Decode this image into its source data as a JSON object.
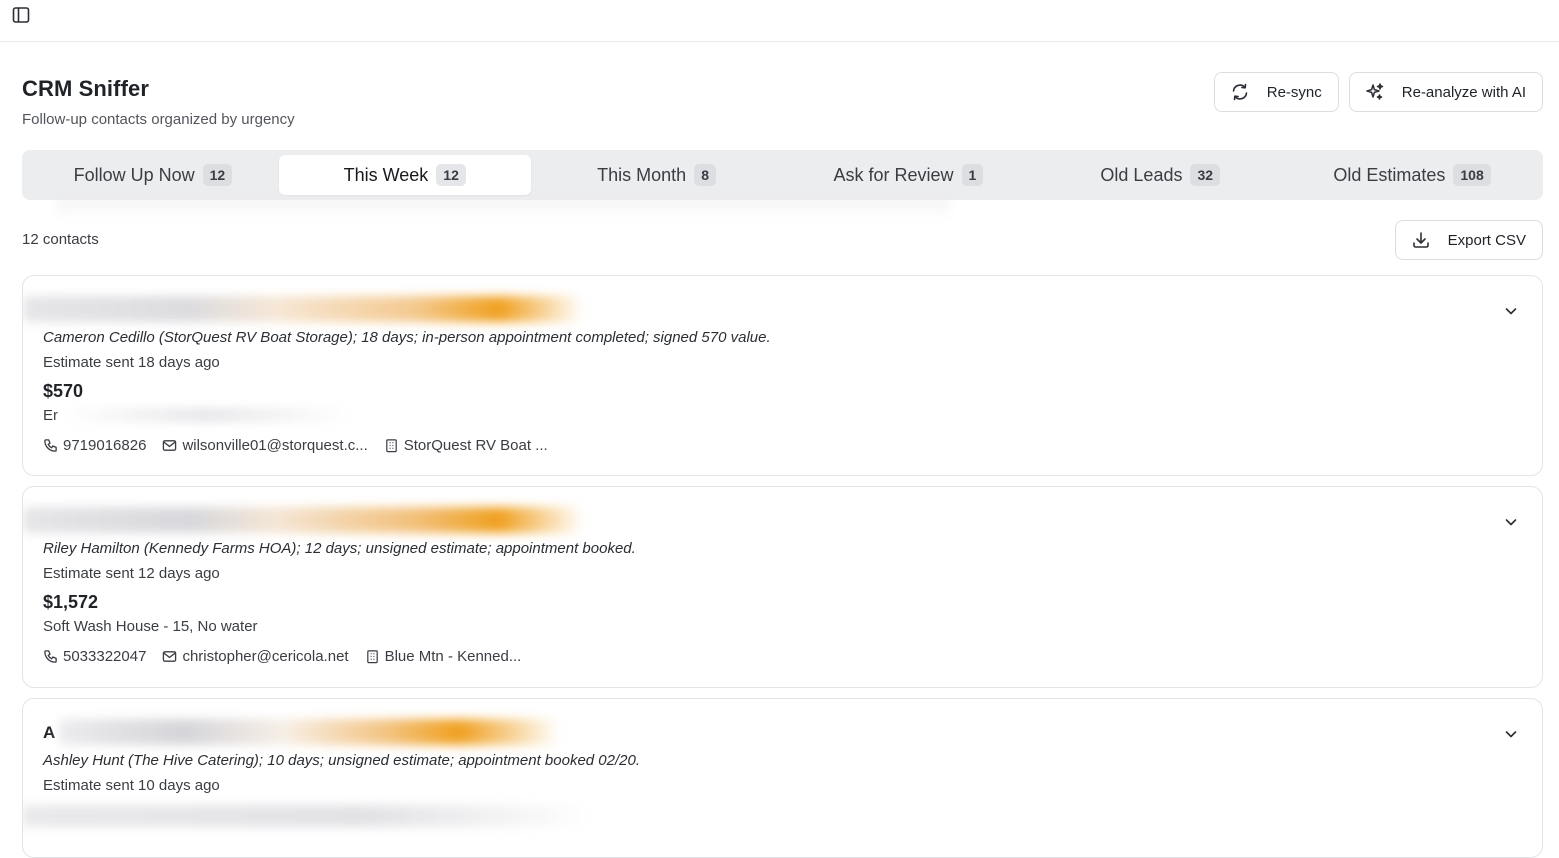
{
  "app": {
    "title": "CRM Sniffer",
    "subtitle": "Follow-up contacts organized by urgency"
  },
  "actions": {
    "resync_label": "Re-sync",
    "reanalyze_label": "Re-analyze with AI",
    "export_label": "Export CSV"
  },
  "tabs": [
    {
      "label": "Follow Up Now",
      "count": "12"
    },
    {
      "label": "This Week",
      "count": "12",
      "active": true
    },
    {
      "label": "This Month",
      "count": "8"
    },
    {
      "label": "Ask for Review",
      "count": "1"
    },
    {
      "label": "Old Leads",
      "count": "32"
    },
    {
      "label": "Old Estimates",
      "count": "108"
    }
  ],
  "list": {
    "count_text": "12 contacts"
  },
  "contacts": [
    {
      "summary": "Cameron Cedillo (StorQuest RV Boat Storage); 18 days; in-person appointment completed; signed 570 value.",
      "sent": "Estimate sent 18 days ago",
      "amount": "$570",
      "service": "Er",
      "phone": "9719016826",
      "email": "wilsonville01@storquest.c...",
      "company": "StorQuest RV Boat ..."
    },
    {
      "summary": "Riley Hamilton (Kennedy Farms HOA); 12 days; unsigned estimate; appointment booked.",
      "sent": "Estimate sent 12 days ago",
      "amount": "$1,572",
      "service": "Soft Wash House - 15, No water",
      "phone": "5033322047",
      "email": "christopher@cericola.net",
      "company": "Blue Mtn - Kenned..."
    },
    {
      "name_partial": "A",
      "summary": "Ashley Hunt (The Hive Catering); 10 days; unsigned estimate; appointment booked 02/20.",
      "sent": "Estimate sent 10 days ago"
    }
  ],
  "colors": {
    "accent_orange": "#f0a020",
    "tab_bg": "#ecedef",
    "border": "#e3e4e7"
  },
  "icons": {
    "sidebar_toggle": "sidebar-toggle-icon",
    "resync": "refresh-icon",
    "reanalyze": "sparkles-icon",
    "export": "download-icon",
    "expand": "chevron-down-icon",
    "phone": "phone-icon",
    "email": "mail-icon",
    "company": "building-icon"
  }
}
